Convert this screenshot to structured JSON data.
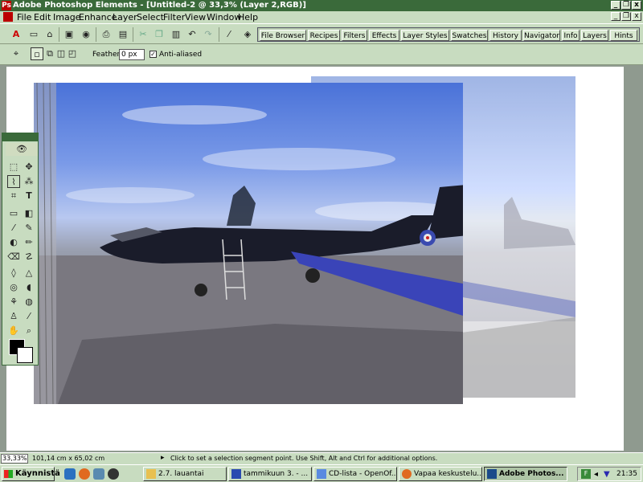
{
  "window": {
    "title": "Adobe Photoshop Elements - [Untitled-2 @ 33,3% (Layer 2,RGB)]",
    "app_icon": "photoshop-elements-icon",
    "controls": [
      "_",
      "❐",
      "x"
    ],
    "doc_controls": [
      "_",
      "❐",
      "x"
    ]
  },
  "menu": [
    "File",
    "Edit",
    "Image",
    "Enhance",
    "Layer",
    "Select",
    "Filter",
    "View",
    "Window",
    "Help"
  ],
  "toolbar": {
    "icons": [
      "adobe-logo-icon",
      "new-icon",
      "open-icon",
      "save-icon",
      "save-web-icon",
      "print-icon",
      "print-preview-icon",
      "cut-icon",
      "copy-icon",
      "paste-icon",
      "undo-icon",
      "redo-icon",
      "eyedropper-icon",
      "quick-fix-icon"
    ]
  },
  "palette_well": [
    "File Browser",
    "Recipes",
    "Filters",
    "Effects",
    "Layer Styles",
    "Swatches",
    "History",
    "Navigator",
    "Info",
    "Layers",
    "Hints"
  ],
  "options": {
    "feather_label": "Feather:",
    "feather_value": "0 px",
    "antialiased_label": "Anti-aliased",
    "antialiased_checked": "✓"
  },
  "status": {
    "zoom": "33,33%",
    "doc_size": "101,14 cm x 65,02 cm",
    "message": "Click to set a selection segment point.  Use Shift, Alt and Ctrl for additional options."
  },
  "taskbar": {
    "start_label": "Käynnistä",
    "tasks": [
      {
        "label": "2.7. lauantai",
        "icon": "folder-icon",
        "color": "#e8c050"
      },
      {
        "label": "tammikuun 3. - ...",
        "icon": "word-icon",
        "color": "#2a4ab0"
      },
      {
        "label": "CD-lista - OpenOf...",
        "icon": "openoffice-icon",
        "color": "#5a8ae0"
      },
      {
        "label": "Vapaa keskustelu...",
        "icon": "firefox-icon",
        "color": "#e06a20"
      },
      {
        "label": "Adobe Photos...",
        "icon": "photoshop-icon",
        "color": "#1a4a8a"
      }
    ],
    "clock": "21:35"
  },
  "colors": {
    "chrome": "#c8dcc0",
    "titlebar": "#3a6a3a"
  }
}
